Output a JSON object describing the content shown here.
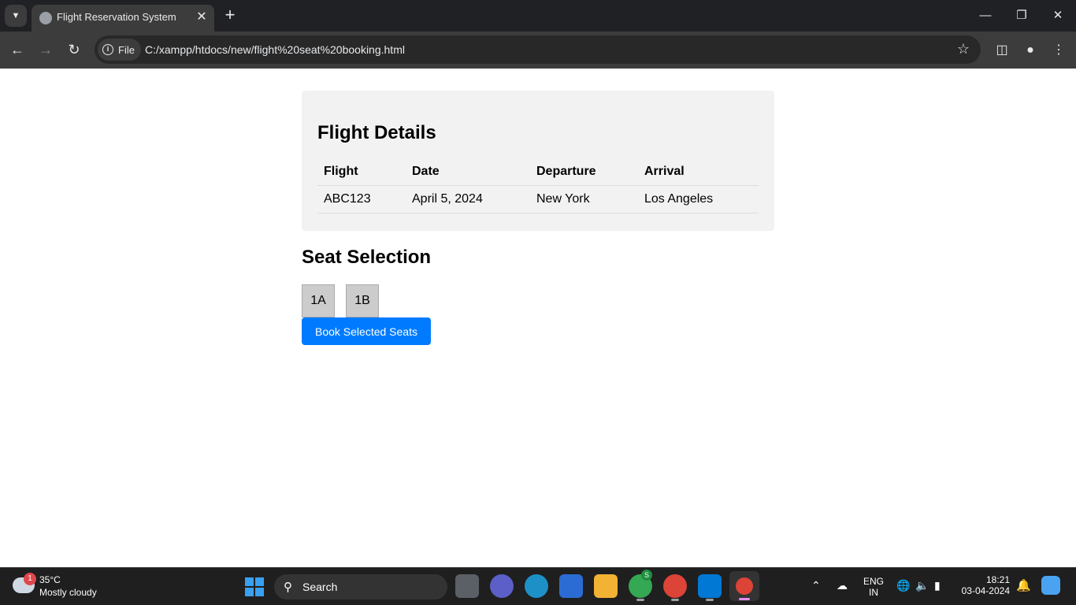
{
  "browser": {
    "tab_title": "Flight Reservation System",
    "url_chip": "File",
    "url": "C:/xampp/htdocs/new/flight%20seat%20booking.html",
    "icons": [
      "tab-search-icon",
      "favicon-icon",
      "close-icon",
      "new-tab-icon",
      "minimize-icon",
      "restore-icon",
      "window-close-icon",
      "back-icon",
      "forward-icon",
      "reload-icon",
      "info-icon",
      "star-icon",
      "sidebar-icon",
      "profile-icon",
      "menu-icon"
    ]
  },
  "flight": {
    "title": "Flight Details",
    "columns": [
      "Flight",
      "Date",
      "Departure",
      "Arrival"
    ],
    "rows": [
      [
        "ABC123",
        "April 5, 2024",
        "New York",
        "Los Angeles"
      ]
    ]
  },
  "seats": {
    "title": "Seat Selection",
    "items": [
      "1A",
      "1B"
    ],
    "book_label": "Book Selected Seats",
    "colors": {
      "seat_bg": "#cccccc",
      "button_bg": "#007bff"
    }
  },
  "taskbar": {
    "weather_badge": "1",
    "weather_temp": "35°C",
    "weather_desc": "Mostly cloudy",
    "search_label": "Search",
    "apps_badge": "S",
    "lang": "ENG",
    "region": "IN",
    "time": "18:21",
    "date": "03-04-2024"
  }
}
